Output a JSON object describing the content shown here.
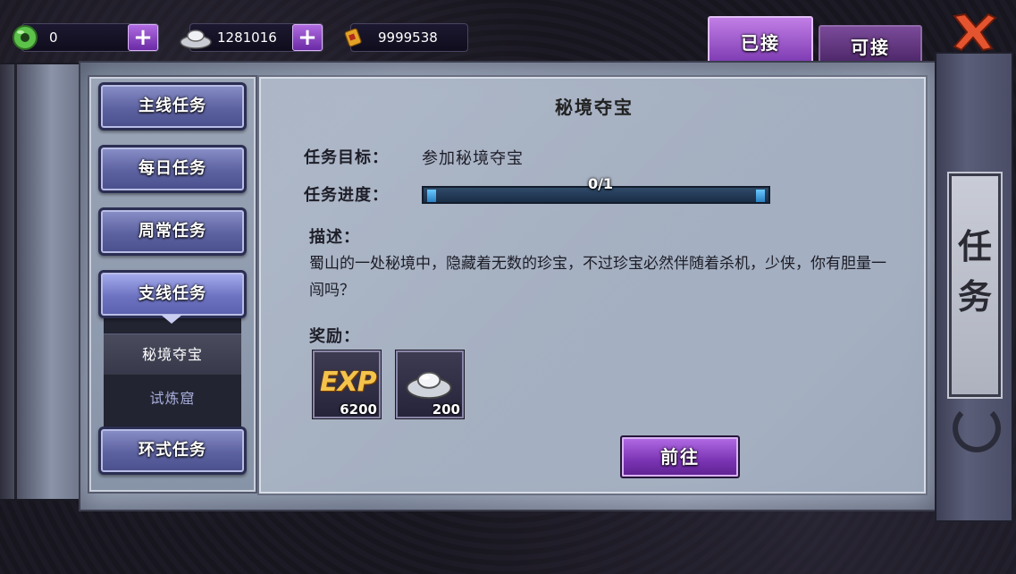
{
  "currency": {
    "jade": {
      "value": "0",
      "icon": "jade-coin-icon"
    },
    "silver": {
      "value": "1281016",
      "icon": "silver-ingot-icon"
    },
    "gold": {
      "value": "9999538",
      "icon": "gold-scroll-icon"
    },
    "plus_label": "+"
  },
  "tabs": {
    "accepted": "已接",
    "available": "可接"
  },
  "categories": {
    "main": "主线任务",
    "daily": "每日任务",
    "weekly": "周常任务",
    "side": "支线任务",
    "ring": "环式任务"
  },
  "side_quests": [
    "秘境夺宝",
    "试炼窟"
  ],
  "quest": {
    "title": "秘境夺宝",
    "target_label": "任务目标：",
    "target_value": "参加秘境夺宝",
    "progress_label": "任务进度：",
    "progress_text": "0/1",
    "progress_fraction": 0,
    "desc_label": "描述：",
    "description": "蜀山的一处秘境中，隐藏着无数的珍宝，不过珍宝必然伴随着杀机，少侠，你有胆量一闯吗？",
    "reward_label": "奖励：",
    "rewards": [
      {
        "name": "EXP",
        "count": "6200"
      },
      {
        "name": "silver",
        "count": "200"
      }
    ],
    "go_button": "前往"
  },
  "scroll_title": "任务",
  "colors": {
    "accent_purple": "#8a3fc4",
    "category_blue": "#5c61a0",
    "progress_blue": "#3a98d4"
  }
}
